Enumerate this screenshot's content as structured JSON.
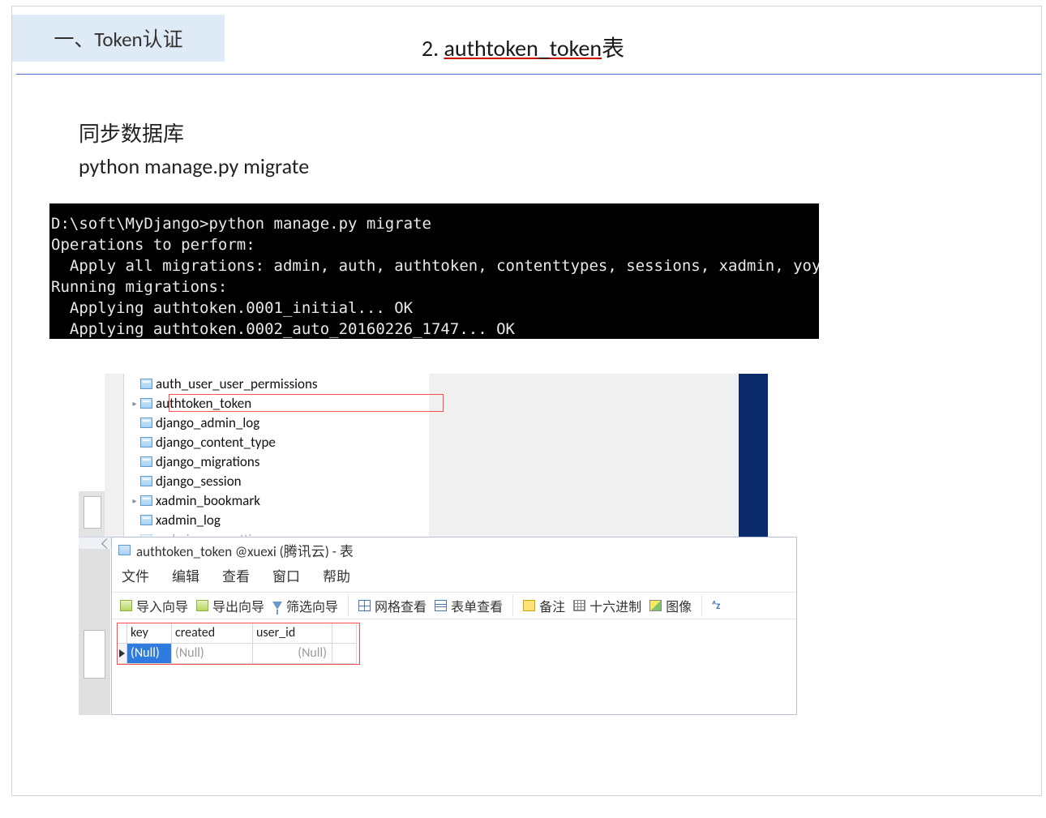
{
  "chapter_tab": "一、Token认证",
  "title_prefix": "2. ",
  "title_underline": "authtoken_token",
  "title_suffix": "表",
  "body": {
    "line1": "同步数据库",
    "line2": "python manage.py migrate"
  },
  "terminal": "D:\\soft\\MyDjango>python manage.py migrate\nOperations to perform:\n  Apply all migrations: admin, auth, authtoken, contenttypes, sessions, xadmin, yoyo\nRunning migrations:\n  Applying authtoken.0001_initial... OK\n  Applying authtoken.0002_auto_20160226_1747... OK",
  "tree": [
    "auth_user_user_permissions",
    "authtoken_token",
    "django_admin_log",
    "django_content_type",
    "django_migrations",
    "django_session",
    "xadmin_bookmark",
    "xadmin_log",
    "xadmin_usersettings"
  ],
  "table_window": {
    "title": "authtoken_token @xuexi (腾讯云) - 表",
    "menu": [
      "文件",
      "编辑",
      "查看",
      "窗口",
      "帮助"
    ],
    "toolbar": {
      "import": "导入向导",
      "export": "导出向导",
      "filter": "筛选向导",
      "gridview": "网格查看",
      "formview": "表单查看",
      "note": "备注",
      "hex": "十六进制",
      "image": "图像",
      "az": "ᴬz"
    },
    "columns": [
      "key",
      "created",
      "user_id"
    ],
    "row": {
      "key": "(Null)",
      "created": "(Null)",
      "user_id": "(Null)"
    }
  }
}
